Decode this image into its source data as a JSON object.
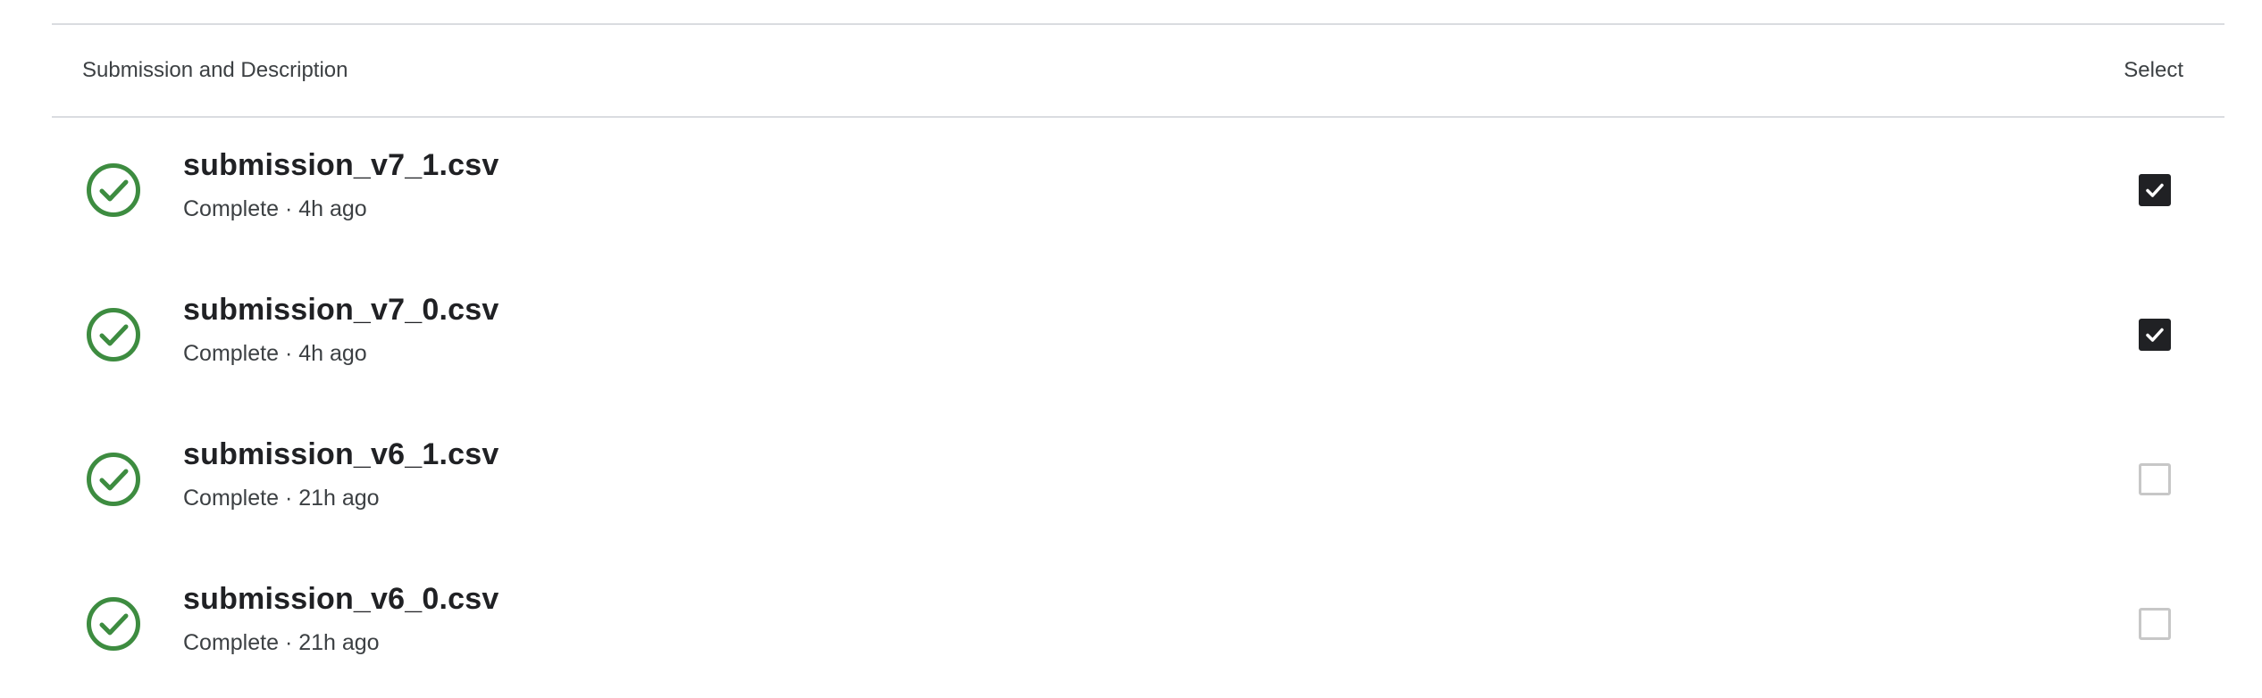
{
  "table": {
    "header": {
      "description_label": "Submission and Description",
      "select_label": "Select"
    },
    "rows": [
      {
        "filename": "submission_v7_1.csv",
        "meta": "Complete · 4h ago",
        "selected": true,
        "status_icon": "check-circle-icon",
        "status_color": "#3d8c40"
      },
      {
        "filename": "submission_v7_0.csv",
        "meta": "Complete · 4h ago",
        "selected": true,
        "status_icon": "check-circle-icon",
        "status_color": "#3d8c40"
      },
      {
        "filename": "submission_v6_1.csv",
        "meta": "Complete · 21h ago",
        "selected": false,
        "status_icon": "check-circle-icon",
        "status_color": "#3d8c40"
      },
      {
        "filename": "submission_v6_0.csv",
        "meta": "Complete · 21h ago",
        "selected": false,
        "status_icon": "check-circle-icon",
        "status_color": "#3d8c40"
      }
    ]
  }
}
